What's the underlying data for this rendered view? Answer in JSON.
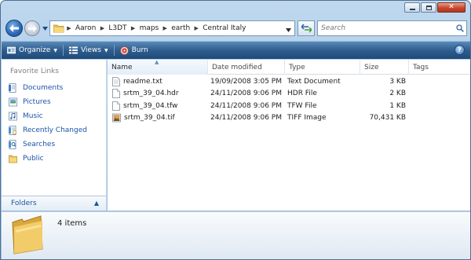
{
  "window": {
    "caption": {
      "minimize_icon": "minimize-icon",
      "maximize_icon": "maximize-icon",
      "close_icon": "close-icon"
    }
  },
  "address": {
    "breadcrumbs": [
      "Aaron",
      "L3DT",
      "maps",
      "earth",
      "Central Italy"
    ]
  },
  "search": {
    "placeholder": "Search"
  },
  "toolbar": {
    "organize_label": "Organize",
    "views_label": "Views",
    "burn_label": "Burn",
    "help_label": "?"
  },
  "nav_pane": {
    "title": "Favorite Links",
    "links": [
      {
        "label": "Documents",
        "icon": "documents-icon"
      },
      {
        "label": "Pictures",
        "icon": "pictures-icon"
      },
      {
        "label": "Music",
        "icon": "music-icon"
      },
      {
        "label": "Recently Changed",
        "icon": "recently-changed-icon"
      },
      {
        "label": "Searches",
        "icon": "searches-icon"
      },
      {
        "label": "Public",
        "icon": "public-folder-icon"
      }
    ],
    "folders_label": "Folders"
  },
  "file_list": {
    "columns": [
      "Name",
      "Date modified",
      "Type",
      "Size",
      "Tags"
    ],
    "sorted_column": "Name",
    "rows": [
      {
        "name": "readme.txt",
        "date": "19/09/2008 3:05 PM",
        "type": "Text Document",
        "size": "3 KB",
        "icon": "text-file-icon"
      },
      {
        "name": "srtm_39_04.hdr",
        "date": "24/11/2008 9:06 PM",
        "type": "HDR File",
        "size": "2 KB",
        "icon": "generic-file-icon"
      },
      {
        "name": "srtm_39_04.tfw",
        "date": "24/11/2008 9:06 PM",
        "type": "TFW File",
        "size": "1 KB",
        "icon": "generic-file-icon"
      },
      {
        "name": "srtm_39_04.tif",
        "date": "24/11/2008 9:06 PM",
        "type": "TIFF Image",
        "size": "70,431 KB",
        "icon": "image-file-icon"
      }
    ]
  },
  "details": {
    "item_count": "4 items"
  },
  "colors": {
    "link_blue": "#1a55a8",
    "toolbar_blue": "#2e5d8e",
    "frame_blue": "#a6c6e4",
    "close_red": "#c8472b"
  }
}
